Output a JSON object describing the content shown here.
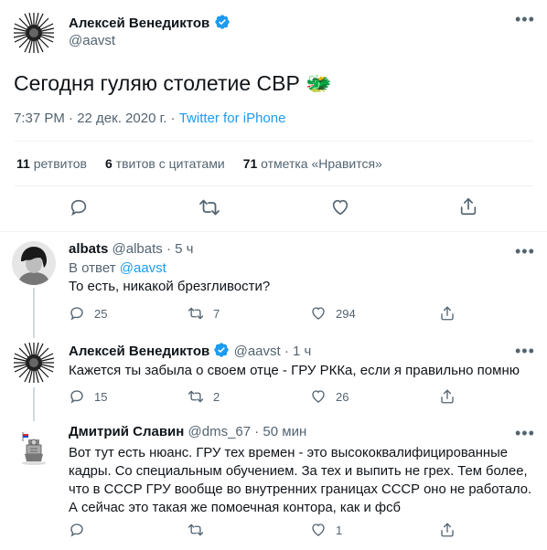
{
  "main_tweet": {
    "author_name": "Алексей Венедиктов",
    "author_handle": "@aavst",
    "text": "Сегодня гуляю столетие СВР 🐲",
    "meta_time": "7:37 PM · 22 дек. 2020 г. · ",
    "meta_source": "Twitter for iPhone",
    "stats": {
      "retweets_count": "11",
      "retweets_label": "ретвитов",
      "quotes_count": "6",
      "quotes_label": "твитов с цитатами",
      "likes_count": "71",
      "likes_label": "отметка «Нравится»"
    }
  },
  "replies": [
    {
      "author_name": "albats",
      "author_handle": "@albats",
      "time": "· 5 ч",
      "reply_to_label": "В ответ ",
      "reply_to_handle": "@aavst",
      "text": "То есть, никакой брезгливости?",
      "replies": "25",
      "retweets": "7",
      "likes": "294"
    },
    {
      "author_name": "Алексей Венедиктов",
      "author_handle": "@aavst",
      "time": "· 1 ч",
      "text": "Кажется ты забыла о своем отце - ГРУ РККа, если я правильно помню",
      "replies": "15",
      "retweets": "2",
      "likes": "26"
    },
    {
      "author_name": "Дмитрий Славин",
      "author_handle": "@dms_67",
      "time": "· 50 мин",
      "text": "Вот тут есть нюанс. ГРУ тех времен - это высококвалифицированные кадры. Со специальным обучением. За тех и выпить не грех. Тем более, что в СССР ГРУ вообще во внутренних границах СССР оно не работало. А сейчас это такая же помоечная контора, как и фсб",
      "replies": "",
      "retweets": "",
      "likes": "1"
    }
  ],
  "colors": {
    "accent": "#1d9bf0",
    "secondary_text": "#536471",
    "divider": "#eff3f4"
  }
}
